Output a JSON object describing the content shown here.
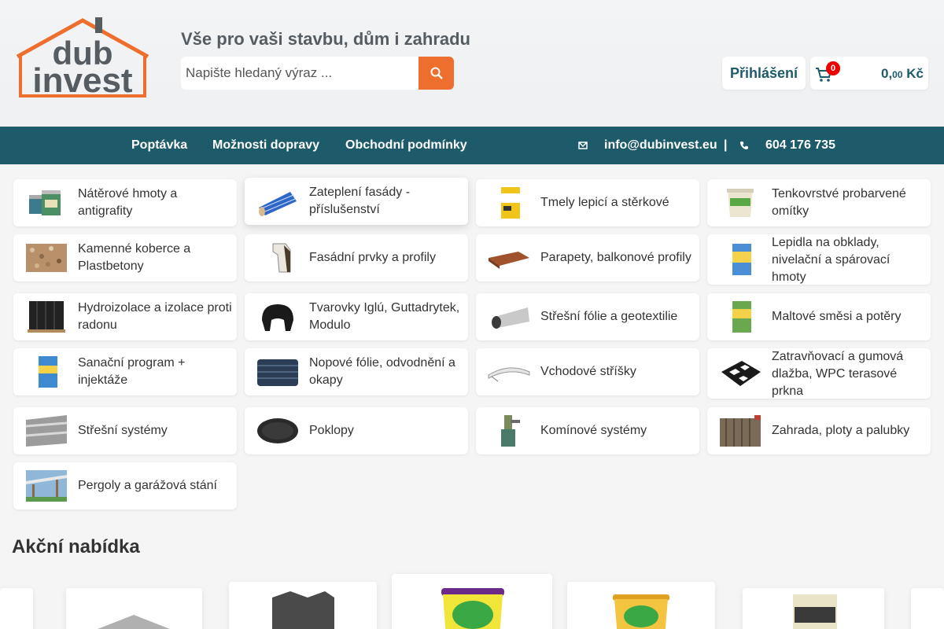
{
  "header": {
    "logo_text_1": "dub",
    "logo_text_2": "invest",
    "tagline": "Vše pro vaši stavbu, dům i zahradu",
    "search_placeholder": "Napište hledaný výraz ...",
    "search_icon": "search-icon",
    "login_label": "Přihlášení",
    "cart": {
      "count": "0",
      "total_main": "0,",
      "total_decimals": "00",
      "currency": " Kč",
      "icon": "cart-icon"
    }
  },
  "nav": {
    "items": [
      "Poptávka",
      "Možnosti dopravy",
      "Obchodní podmínky"
    ],
    "email": "info@dubinvest.eu",
    "separator": "|",
    "phone": "604 176 735"
  },
  "categories": [
    "Nátěrové hmoty a antigrafity",
    "Zateplení fasády - příslušenství",
    "Tmely lepicí a stěrkové",
    "Tenkovrstvé probarvené omítky",
    "Kamenné koberce a Plastbetony",
    "Fasádní prvky a profily",
    "Parapety, balkonové profily",
    "Lepidla na obklady, nivelační a spárovací hmoty",
    "Hydroizolace a izolace proti radonu",
    "Tvarovky Iglú, Guttadrytek, Modulo",
    "Střešní fólie a geotextilie",
    "Maltové směsi a potěry",
    "Sanační program + injektáže",
    "Nopové fólie, odvodnění a okapy",
    "Vchodové stříšky",
    "Zatravňovací a gumová dlažba, WPC terasové prkna",
    "Střešní systémy",
    "Poklopy",
    "Komínové systémy",
    "Zahrada, ploty a palubky",
    "Pergoly a garážová stání"
  ],
  "offers": {
    "title": "Akční nabídka"
  },
  "colors": {
    "brand": "#1d5b6b",
    "accent": "#ee6f2d",
    "logo_orange": "#ee6f2d",
    "logo_gray": "#555d63"
  }
}
